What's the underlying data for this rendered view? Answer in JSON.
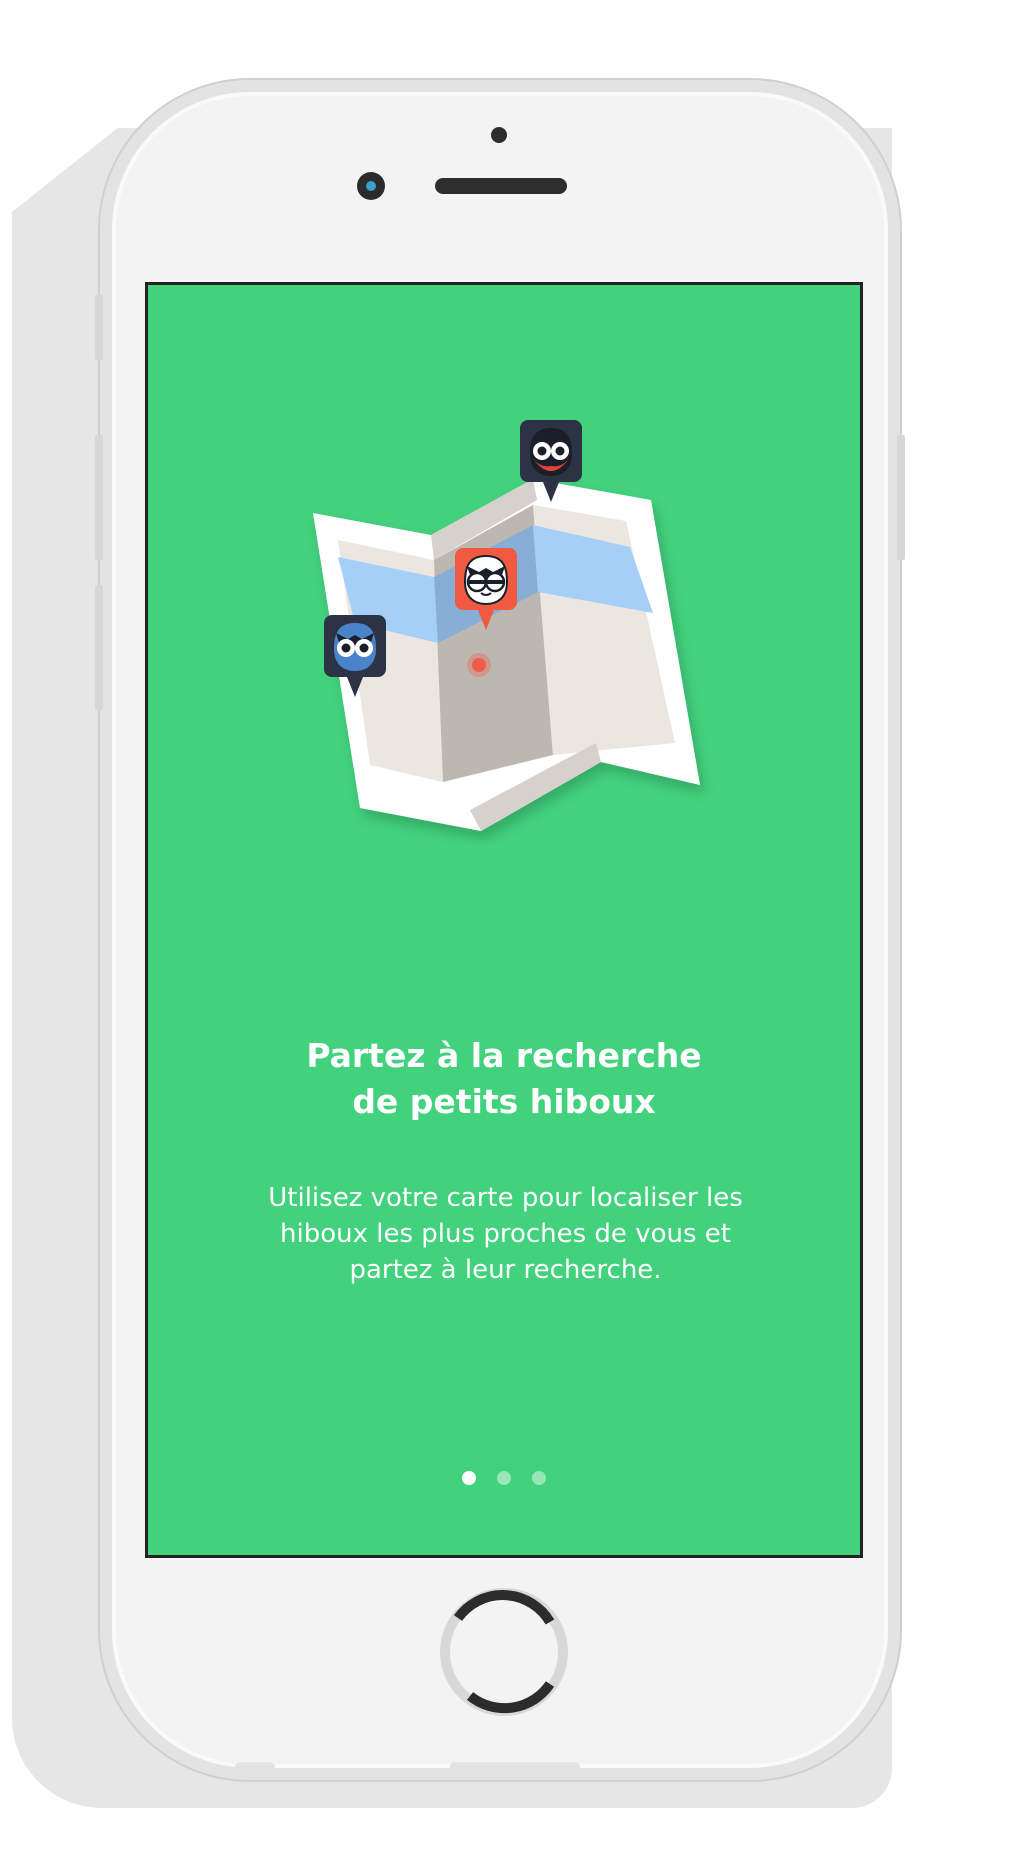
{
  "onboarding": {
    "title_line1": "Partez à la recherche",
    "title_line2": "de petits hiboux",
    "description_line1": "Utilisez votre carte pour localiser les",
    "description_line2": "hiboux les plus proches de vous et",
    "description_line3": "partez à leur recherche.",
    "current_page": 1,
    "page_count": 3
  },
  "colors": {
    "screen_background": "#42d17d",
    "map_water": "#a5cff7",
    "owl_pin_dark": "#2b3344",
    "owl_pin_red": "#ef5a40",
    "location_dot": "#f05c4a"
  },
  "icons": {
    "map": "folded-map-icon",
    "owl_pins": [
      "owl-pin-blue-icon",
      "owl-pin-red-icon",
      "owl-pin-dark-red-beak-icon"
    ],
    "location": "location-dot-icon"
  }
}
